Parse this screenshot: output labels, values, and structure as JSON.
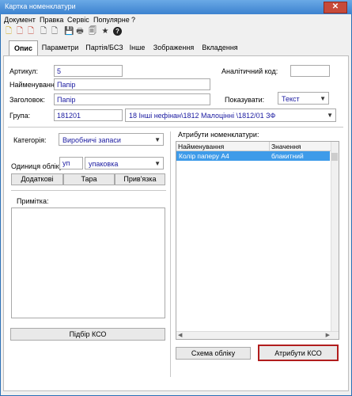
{
  "window": {
    "title": "Картка номенклатури",
    "close_label": "✕"
  },
  "menu": [
    {
      "label": "Документ"
    },
    {
      "label": "Правка"
    },
    {
      "label": "Сервіс"
    },
    {
      "label": "Популярне"
    },
    {
      "label": "?"
    }
  ],
  "toolbar": [
    {
      "icon": "new-document-icon",
      "glyph": "🗋"
    },
    {
      "icon": "new-document-red-icon",
      "glyph": "🗋"
    },
    {
      "icon": "copy-document-icon",
      "glyph": "🗋"
    },
    {
      "icon": "page-icon",
      "glyph": "🗋"
    },
    {
      "icon": "page-up-icon",
      "glyph": "🗋"
    },
    {
      "icon": "save-icon",
      "glyph": "💾"
    },
    {
      "icon": "print-icon",
      "glyph": "🖶"
    },
    {
      "icon": "preview-icon",
      "glyph": "🗐"
    },
    {
      "icon": "star-icon",
      "glyph": "★"
    },
    {
      "icon": "help-icon",
      "glyph": "?"
    }
  ],
  "tabs": [
    {
      "label": "Опис",
      "active": true
    },
    {
      "label": "Параметри"
    },
    {
      "label": "Партія/БСЗ"
    },
    {
      "label": "Інше"
    },
    {
      "label": "Зображення"
    },
    {
      "label": "Вкладення"
    }
  ],
  "form": {
    "article_label": "Артикул:",
    "article_value": "5",
    "analytic_label": "Аналітичний код:",
    "analytic_value": "",
    "name_label": "Найменування:",
    "name_value": "Папір",
    "header_label": "Заголовок:",
    "header_value": "Папір",
    "show_label": "Показувати:",
    "show_value": "Текст",
    "group_label": "Група:",
    "group_code": "181201",
    "group_name": "18 Інші нефінан\\1812 Малоцінні \\1812/01 ЗФ",
    "category_label": "Категорія:",
    "category_value": "Виробничі запаси",
    "unit_label": "Одиниця обліку",
    "unit_code": "уп",
    "unit_name": "упаковка",
    "btn_extra": "Додаткові",
    "btn_tare": "Тара",
    "btn_binding": "Прив'язка",
    "note_label": "Примітка:",
    "note_value": "",
    "btn_kso": "Підбір КСО",
    "attr_label": "Атрибути номенклатури:",
    "btn_scheme": "Схема обліку",
    "btn_attr_kso": "Атрибути КСО"
  },
  "attributes": {
    "columns": [
      "Найменування",
      "Значення"
    ],
    "rows": [
      [
        "Колір паперу А4",
        "блакитний"
      ]
    ]
  },
  "colors": {
    "accent": "#3e9be9",
    "value_text": "#1a1aa0",
    "highlight_border": "#b11d1d"
  }
}
